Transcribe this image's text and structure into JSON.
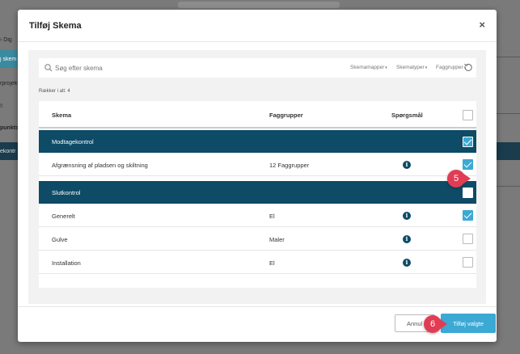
{
  "background": {
    "left_rows": [
      "Dig",
      "j skem",
      "rprojekt",
      "lt",
      "punkts",
      "ekontr"
    ],
    "chevron": "chevron-right-icon"
  },
  "modal": {
    "title": "Tilføj Skema",
    "close_glyph": "×",
    "search": {
      "placeholder": "Søg efter skema",
      "value": ""
    },
    "filters": [
      {
        "label": "Skemamapper"
      },
      {
        "label": "Skematyper"
      },
      {
        "label": "Faggrupper"
      }
    ],
    "rows_count": "Rækker i alt: 4",
    "table": {
      "headers": {
        "schema": "Skema",
        "groups": "Faggrupper",
        "questions": "Spørgsmål"
      },
      "header_checked": false,
      "groups": [
        {
          "label": "Modtagekontrol",
          "checked": true,
          "rows": [
            {
              "schema": "Afgrænsning af pladsen og skiltning",
              "groups": "12 Faggrupper",
              "info": "i",
              "checked": true
            }
          ]
        },
        {
          "label": "Slutkontrol",
          "checked": false,
          "rows": [
            {
              "schema": "Generelt",
              "groups": "El",
              "info": "i",
              "checked": true
            },
            {
              "schema": "Gulve",
              "groups": "Maler",
              "info": "i",
              "checked": false
            },
            {
              "schema": "Installation",
              "groups": "El",
              "info": "i",
              "checked": false
            }
          ]
        }
      ]
    },
    "footer": {
      "cancel_label": "Annul",
      "submit_label": "Tilføj valgte"
    },
    "callouts": [
      {
        "number": "5"
      },
      {
        "number": "6"
      }
    ]
  },
  "colors": {
    "group_row": "#0d4b66",
    "accent": "#3ba9d4",
    "callout": "#e23c55"
  }
}
